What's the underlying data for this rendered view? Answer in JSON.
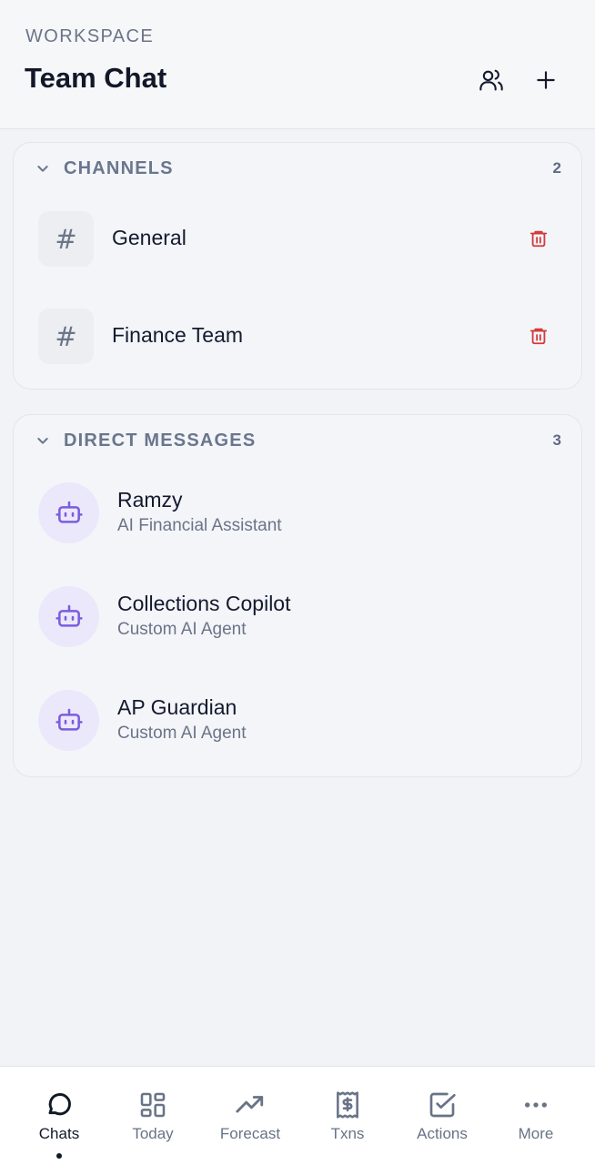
{
  "header": {
    "eyebrow": "WORKSPACE",
    "title": "Team Chat"
  },
  "channels": {
    "title": "CHANNELS",
    "count": "2",
    "items": [
      {
        "icon": "#",
        "name": "General"
      },
      {
        "icon": "#",
        "name": "Finance Team"
      }
    ]
  },
  "direct_messages": {
    "title": "DIRECT MESSAGES",
    "count": "3",
    "items": [
      {
        "name": "Ramzy",
        "subtitle": "AI Financial Assistant"
      },
      {
        "name": "Collections Copilot",
        "subtitle": "Custom AI Agent"
      },
      {
        "name": "AP Guardian",
        "subtitle": "Custom AI Agent"
      }
    ]
  },
  "nav": {
    "active": "Chats",
    "items": [
      {
        "label": "Chats",
        "icon": "chat-bubble-icon"
      },
      {
        "label": "Today",
        "icon": "dashboard-grid-icon"
      },
      {
        "label": "Forecast",
        "icon": "trending-up-icon"
      },
      {
        "label": "Txns",
        "icon": "receipt-dollar-icon"
      },
      {
        "label": "Actions",
        "icon": "checkbox-icon"
      },
      {
        "label": "More",
        "icon": "more-dots-icon"
      }
    ]
  },
  "colors": {
    "accent_purple": "#7c5ce0",
    "avatar_bg": "#ebe8fb",
    "delete_red": "#d33a3a",
    "text_primary": "#141a2e",
    "text_muted": "#6b7487"
  }
}
